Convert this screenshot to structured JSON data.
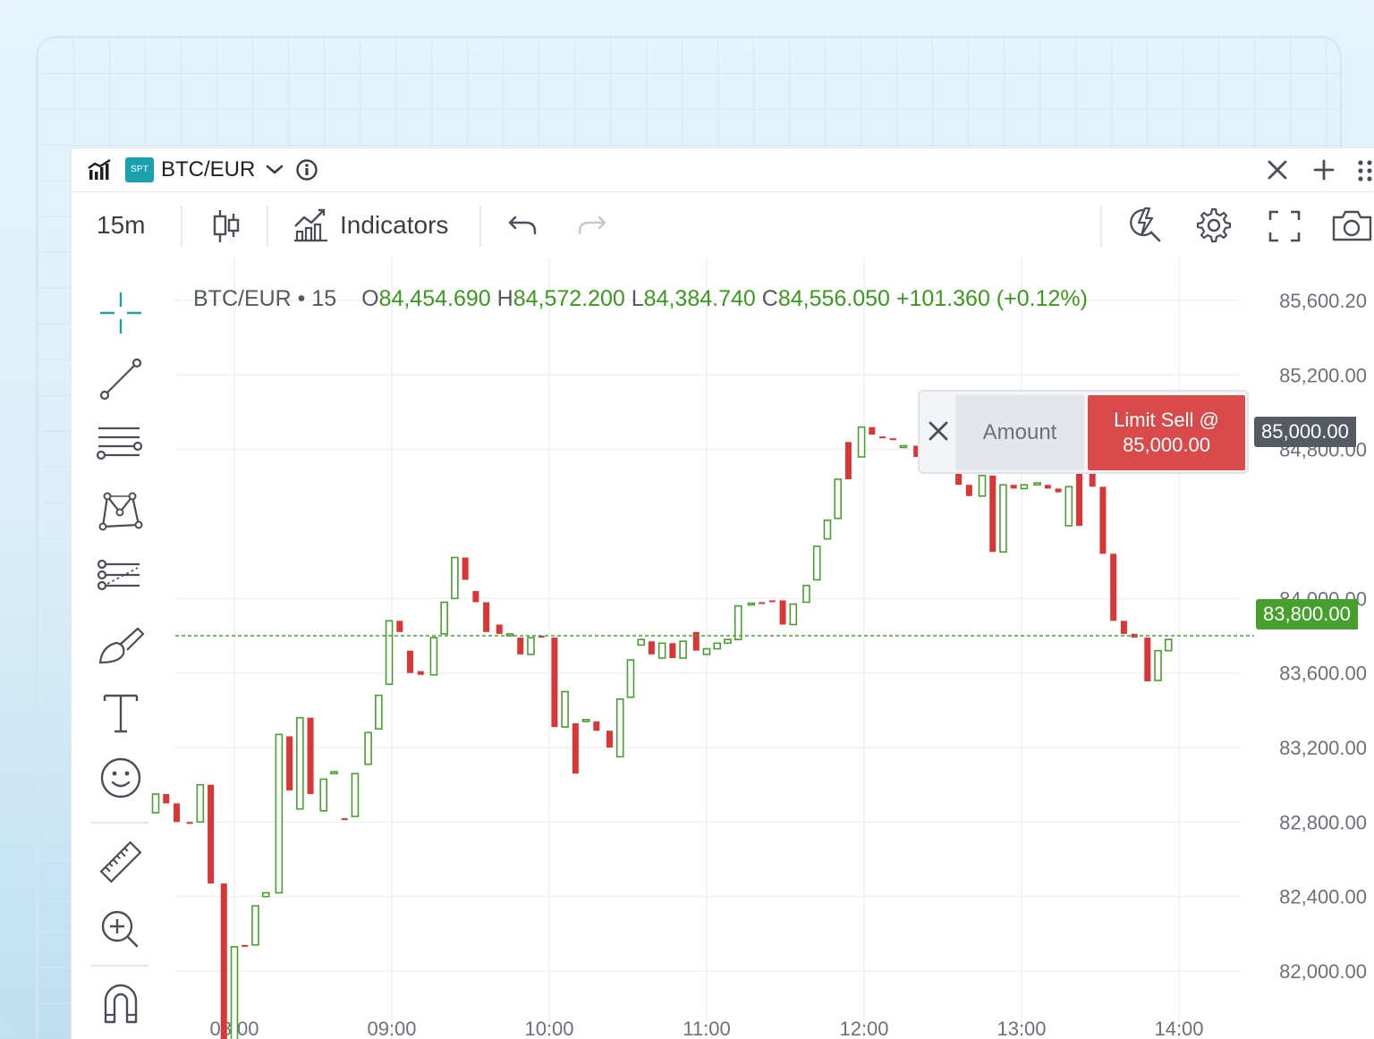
{
  "window": {
    "symbol": "BTC/EUR",
    "badge": "SPT"
  },
  "toolbar": {
    "interval": "15m",
    "indicators_label": "Indicators"
  },
  "legend": {
    "symbol_interval": "BTC/EUR • 15",
    "o_label": "O",
    "o_value": "84,454.690",
    "h_label": "H",
    "h_value": "84,572.200",
    "l_label": "L",
    "l_value": "84,384.740",
    "c_label": "C",
    "c_value": "84,556.050",
    "change": "+101.360 (+0.12%)"
  },
  "order_panel": {
    "amount_placeholder": "Amount",
    "limit_line1": "Limit Sell @",
    "limit_line2": "85,000.00",
    "order_price_tag": "85,000.00",
    "last_price_tag": "83,800.00"
  },
  "colors": {
    "up": "#47a02d",
    "down": "#db3636",
    "limit_sell": "#d94b4b",
    "badge": "#1aa3ad"
  },
  "chart_data": {
    "type": "candlestick",
    "price_axis_ticks": [
      "85,600.20",
      "85,200.00",
      "84,800.00",
      "84,000.00",
      "83,600.00",
      "83,200.00",
      "82,800.00",
      "82,400.00",
      "82,000.00"
    ],
    "price_axis_values": [
      85600,
      85200,
      84800,
      84000,
      83600,
      83200,
      82800,
      82400,
      82000
    ],
    "time_axis_labels": [
      "08:00",
      "09:00",
      "10:00",
      "11:00",
      "12:00",
      "13:00",
      "14:00"
    ],
    "time_axis_minutes": [
      480,
      540,
      600,
      660,
      720,
      780,
      840
    ],
    "last_price": 83800,
    "order_price": 85000,
    "candles": [
      {
        "t": 450,
        "open": 82850,
        "close": 82950,
        "up": true
      },
      {
        "t": 454,
        "open": 82950,
        "close": 82900,
        "up": false
      },
      {
        "t": 458,
        "open": 82900,
        "close": 82800,
        "up": false
      },
      {
        "t": 463,
        "open": 82800,
        "close": 82795,
        "up": false
      },
      {
        "t": 467,
        "open": 82800,
        "close": 83000,
        "up": true
      },
      {
        "t": 471,
        "open": 83000,
        "close": 82470,
        "up": false
      },
      {
        "t": 476,
        "open": 82470,
        "close": 81520,
        "up": false
      },
      {
        "t": 480,
        "open": 81500,
        "close": 82130,
        "up": true
      },
      {
        "t": 484,
        "open": 82130,
        "close": 82140,
        "up": false
      },
      {
        "t": 488,
        "open": 82140,
        "close": 82350,
        "up": true
      },
      {
        "t": 492,
        "open": 82400,
        "close": 82420,
        "up": true
      },
      {
        "t": 497,
        "open": 82420,
        "close": 83270,
        "up": true
      },
      {
        "t": 501,
        "open": 83260,
        "close": 82970,
        "up": false
      },
      {
        "t": 505,
        "open": 82870,
        "close": 83360,
        "up": true
      },
      {
        "t": 509,
        "open": 83360,
        "close": 82950,
        "up": false
      },
      {
        "t": 514,
        "open": 82860,
        "close": 83030,
        "up": true
      },
      {
        "t": 518,
        "open": 83060,
        "close": 83070,
        "up": true
      },
      {
        "t": 522,
        "open": 82820,
        "close": 82815,
        "up": false
      },
      {
        "t": 526,
        "open": 82830,
        "close": 83060,
        "up": true
      },
      {
        "t": 531,
        "open": 83110,
        "close": 83280,
        "up": true
      },
      {
        "t": 535,
        "open": 83300,
        "close": 83480,
        "up": true
      },
      {
        "t": 539,
        "open": 83540,
        "close": 83880,
        "up": true
      },
      {
        "t": 543,
        "open": 83880,
        "close": 83820,
        "up": false
      },
      {
        "t": 547,
        "open": 83720,
        "close": 83600,
        "up": false
      },
      {
        "t": 551,
        "open": 83610,
        "close": 83590,
        "up": false
      },
      {
        "t": 556,
        "open": 83590,
        "close": 83790,
        "up": true
      },
      {
        "t": 560,
        "open": 83810,
        "close": 83980,
        "up": true
      },
      {
        "t": 564,
        "open": 84000,
        "close": 84220,
        "up": true
      },
      {
        "t": 568,
        "open": 84220,
        "close": 84100,
        "up": false
      },
      {
        "t": 572,
        "open": 84040,
        "close": 83980,
        "up": false
      },
      {
        "t": 576,
        "open": 83980,
        "close": 83820,
        "up": false
      },
      {
        "t": 581,
        "open": 83860,
        "close": 83810,
        "up": false
      },
      {
        "t": 585,
        "open": 83810,
        "close": 83800,
        "up": true
      },
      {
        "t": 589,
        "open": 83790,
        "close": 83700,
        "up": false
      },
      {
        "t": 593,
        "open": 83700,
        "close": 83790,
        "up": true
      },
      {
        "t": 597,
        "open": 83790,
        "close": 83800,
        "up": false
      },
      {
        "t": 602,
        "open": 83790,
        "close": 83310,
        "up": false
      },
      {
        "t": 606,
        "open": 83310,
        "close": 83500,
        "up": true
      },
      {
        "t": 610,
        "open": 83330,
        "close": 83060,
        "up": false
      },
      {
        "t": 614,
        "open": 83340,
        "close": 83350,
        "up": true
      },
      {
        "t": 618,
        "open": 83340,
        "close": 83290,
        "up": false
      },
      {
        "t": 623,
        "open": 83290,
        "close": 83200,
        "up": false
      },
      {
        "t": 627,
        "open": 83150,
        "close": 83460,
        "up": true
      },
      {
        "t": 631,
        "open": 83470,
        "close": 83670,
        "up": true
      },
      {
        "t": 635,
        "open": 83750,
        "close": 83780,
        "up": true
      },
      {
        "t": 639,
        "open": 83770,
        "close": 83700,
        "up": false
      },
      {
        "t": 643,
        "open": 83680,
        "close": 83760,
        "up": true
      },
      {
        "t": 647,
        "open": 83760,
        "close": 83680,
        "up": false
      },
      {
        "t": 651,
        "open": 83680,
        "close": 83770,
        "up": true
      },
      {
        "t": 656,
        "open": 83820,
        "close": 83720,
        "up": false
      },
      {
        "t": 660,
        "open": 83700,
        "close": 83730,
        "up": true
      },
      {
        "t": 664,
        "open": 83730,
        "close": 83760,
        "up": true
      },
      {
        "t": 668,
        "open": 83760,
        "close": 83780,
        "up": true
      },
      {
        "t": 672,
        "open": 83780,
        "close": 83960,
        "up": true
      },
      {
        "t": 677,
        "open": 83970,
        "close": 83975,
        "up": true
      },
      {
        "t": 681,
        "open": 83975,
        "close": 83980,
        "up": false
      },
      {
        "t": 685,
        "open": 83985,
        "close": 83990,
        "up": false
      },
      {
        "t": 689,
        "open": 83990,
        "close": 83860,
        "up": false
      },
      {
        "t": 693,
        "open": 83860,
        "close": 83970,
        "up": true
      },
      {
        "t": 698,
        "open": 83980,
        "close": 84070,
        "up": true
      },
      {
        "t": 702,
        "open": 84100,
        "close": 84280,
        "up": true
      },
      {
        "t": 706,
        "open": 84320,
        "close": 84420,
        "up": true
      },
      {
        "t": 710,
        "open": 84430,
        "close": 84640,
        "up": true
      },
      {
        "t": 714,
        "open": 84640,
        "close": 84840,
        "up": false
      },
      {
        "t": 719,
        "open": 84760,
        "close": 84920,
        "up": true
      },
      {
        "t": 723,
        "open": 84920,
        "close": 84880,
        "up": false
      },
      {
        "t": 727,
        "open": 84870,
        "close": 84860,
        "up": false
      },
      {
        "t": 731,
        "open": 84860,
        "close": 84850,
        "up": false
      },
      {
        "t": 735,
        "open": 84820,
        "close": 84820,
        "up": true
      },
      {
        "t": 740,
        "open": 84820,
        "close": 84760,
        "up": false
      },
      {
        "t": 744,
        "open": 84760,
        "close": 84770,
        "up": true
      },
      {
        "t": 748,
        "open": 84770,
        "close": 84770,
        "up": true
      },
      {
        "t": 752,
        "open": 84780,
        "close": 84775,
        "up": false
      },
      {
        "t": 756,
        "open": 84770,
        "close": 84610,
        "up": false
      },
      {
        "t": 760,
        "open": 84610,
        "close": 84550,
        "up": false
      },
      {
        "t": 765,
        "open": 84550,
        "close": 84660,
        "up": true
      },
      {
        "t": 769,
        "open": 84660,
        "close": 84250,
        "up": false
      },
      {
        "t": 773,
        "open": 84250,
        "close": 84610,
        "up": true
      },
      {
        "t": 777,
        "open": 84610,
        "close": 84590,
        "up": false
      },
      {
        "t": 781,
        "open": 84590,
        "close": 84610,
        "up": true
      },
      {
        "t": 786,
        "open": 84610,
        "close": 84620,
        "up": true
      },
      {
        "t": 790,
        "open": 84610,
        "close": 84590,
        "up": false
      },
      {
        "t": 794,
        "open": 84590,
        "close": 84570,
        "up": false
      },
      {
        "t": 798,
        "open": 84600,
        "close": 84390,
        "up": true
      },
      {
        "t": 802,
        "open": 84390,
        "close": 84750,
        "up": false
      },
      {
        "t": 807,
        "open": 84750,
        "close": 84600,
        "up": false
      },
      {
        "t": 811,
        "open": 84600,
        "close": 84240,
        "up": false
      },
      {
        "t": 815,
        "open": 84240,
        "close": 83880,
        "up": false
      },
      {
        "t": 819,
        "open": 83880,
        "close": 83810,
        "up": false
      },
      {
        "t": 823,
        "open": 83810,
        "close": 83790,
        "up": false
      },
      {
        "t": 828,
        "open": 83790,
        "close": 83555,
        "up": false
      },
      {
        "t": 832,
        "open": 83560,
        "close": 83720,
        "up": true
      },
      {
        "t": 836,
        "open": 83720,
        "close": 83780,
        "up": true
      }
    ]
  }
}
